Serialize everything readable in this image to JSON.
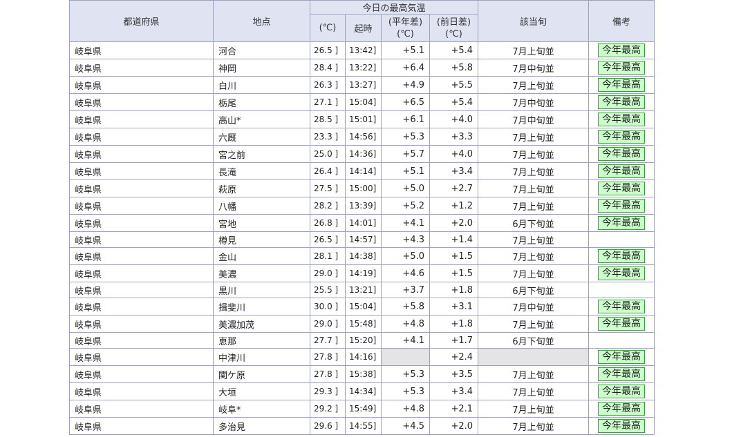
{
  "header": {
    "prefecture": "都道府県",
    "location": "地点",
    "group": "今日の最高気温",
    "temp": "(℃)",
    "time": "起時",
    "normal_diff_1": "(平年差)",
    "normal_diff_2": "(℃)",
    "prev_diff_1": "(前日差)",
    "prev_diff_2": "(℃)",
    "season": "該当旬",
    "note": "備考"
  },
  "rows": [
    {
      "pref": "岐阜県",
      "loc": "河合",
      "temp": "26.5 ]",
      "time": "13:42]",
      "normal": "+5.1",
      "prev": "+5.4",
      "season": "7月上旬並",
      "note": "今年最高"
    },
    {
      "pref": "岐阜県",
      "loc": "神岡",
      "temp": "28.4 ]",
      "time": "13:22]",
      "normal": "+6.4",
      "prev": "+5.8",
      "season": "7月中旬並",
      "note": "今年最高"
    },
    {
      "pref": "岐阜県",
      "loc": "白川",
      "temp": "26.3 ]",
      "time": "13:27]",
      "normal": "+4.9",
      "prev": "+5.5",
      "season": "7月上旬並",
      "note": "今年最高"
    },
    {
      "pref": "岐阜県",
      "loc": "栃尾",
      "temp": "27.1 ]",
      "time": "15:04]",
      "normal": "+6.5",
      "prev": "+5.4",
      "season": "7月中旬並",
      "note": "今年最高"
    },
    {
      "pref": "岐阜県",
      "loc": "高山*",
      "temp": "28.5 ]",
      "time": "15:01]",
      "normal": "+6.1",
      "prev": "+4.0",
      "season": "7月中旬並",
      "note": "今年最高"
    },
    {
      "pref": "岐阜県",
      "loc": "六厩",
      "temp": "23.3 ]",
      "time": "14:56]",
      "normal": "+5.3",
      "prev": "+3.3",
      "season": "7月上旬並",
      "note": "今年最高"
    },
    {
      "pref": "岐阜県",
      "loc": "宮之前",
      "temp": "25.0 ]",
      "time": "14:36]",
      "normal": "+5.7",
      "prev": "+4.0",
      "season": "7月上旬並",
      "note": "今年最高"
    },
    {
      "pref": "岐阜県",
      "loc": "長滝",
      "temp": "26.4 ]",
      "time": "14:14]",
      "normal": "+5.1",
      "prev": "+3.4",
      "season": "7月上旬並",
      "note": "今年最高"
    },
    {
      "pref": "岐阜県",
      "loc": "萩原",
      "temp": "27.5 ]",
      "time": "15:00]",
      "normal": "+5.0",
      "prev": "+2.7",
      "season": "7月上旬並",
      "note": "今年最高"
    },
    {
      "pref": "岐阜県",
      "loc": "八幡",
      "temp": "28.2 ]",
      "time": "13:39]",
      "normal": "+5.2",
      "prev": "+1.2",
      "season": "7月上旬並",
      "note": "今年最高"
    },
    {
      "pref": "岐阜県",
      "loc": "宮地",
      "temp": "26.8 ]",
      "time": "14:01]",
      "normal": "+4.1",
      "prev": "+2.0",
      "season": "6月下旬並",
      "note": "今年最高"
    },
    {
      "pref": "岐阜県",
      "loc": "樽見",
      "temp": "26.5 ]",
      "time": "14:57]",
      "normal": "+4.3",
      "prev": "+1.4",
      "season": "7月上旬並",
      "note": ""
    },
    {
      "pref": "岐阜県",
      "loc": "金山",
      "temp": "28.1 ]",
      "time": "14:38]",
      "normal": "+5.0",
      "prev": "+1.5",
      "season": "7月上旬並",
      "note": "今年最高"
    },
    {
      "pref": "岐阜県",
      "loc": "美濃",
      "temp": "29.0 ]",
      "time": "14:19]",
      "normal": "+4.6",
      "prev": "+1.5",
      "season": "7月上旬並",
      "note": "今年最高"
    },
    {
      "pref": "岐阜県",
      "loc": "黒川",
      "temp": "25.5 ]",
      "time": "13:21]",
      "normal": "+3.7",
      "prev": "+1.8",
      "season": "6月下旬並",
      "note": ""
    },
    {
      "pref": "岐阜県",
      "loc": "揖斐川",
      "temp": "30.0 ]",
      "time": "15:04]",
      "normal": "+5.8",
      "prev": "+3.1",
      "season": "7月中旬並",
      "note": "今年最高"
    },
    {
      "pref": "岐阜県",
      "loc": "美濃加茂",
      "temp": "29.0 ]",
      "time": "15:48]",
      "normal": "+4.8",
      "prev": "+1.8",
      "season": "7月上旬並",
      "note": "今年最高"
    },
    {
      "pref": "岐阜県",
      "loc": "恵那",
      "temp": "27.7 ]",
      "time": "15:20]",
      "normal": "+4.1",
      "prev": "+1.7",
      "season": "6月下旬並",
      "note": ""
    },
    {
      "pref": "岐阜県",
      "loc": "中津川",
      "temp": "27.8 ]",
      "time": "14:16]",
      "normal": "",
      "prev": "+2.4",
      "season": "",
      "note": "今年最高"
    },
    {
      "pref": "岐阜県",
      "loc": "関ケ原",
      "temp": "27.8 ]",
      "time": "15:38]",
      "normal": "+5.3",
      "prev": "+3.5",
      "season": "7月上旬並",
      "note": "今年最高"
    },
    {
      "pref": "岐阜県",
      "loc": "大垣",
      "temp": "29.3 ]",
      "time": "14:34]",
      "normal": "+5.3",
      "prev": "+3.4",
      "season": "7月上旬並",
      "note": "今年最高"
    },
    {
      "pref": "岐阜県",
      "loc": "岐阜*",
      "temp": "29.2 ]",
      "time": "15:49]",
      "normal": "+4.8",
      "prev": "+2.1",
      "season": "7月上旬並",
      "note": "今年最高"
    },
    {
      "pref": "岐阜県",
      "loc": "多治見",
      "temp": "29.6 ]",
      "time": "14:55]",
      "normal": "+4.5",
      "prev": "+2.0",
      "season": "7月上旬並",
      "note": "今年最高"
    }
  ]
}
